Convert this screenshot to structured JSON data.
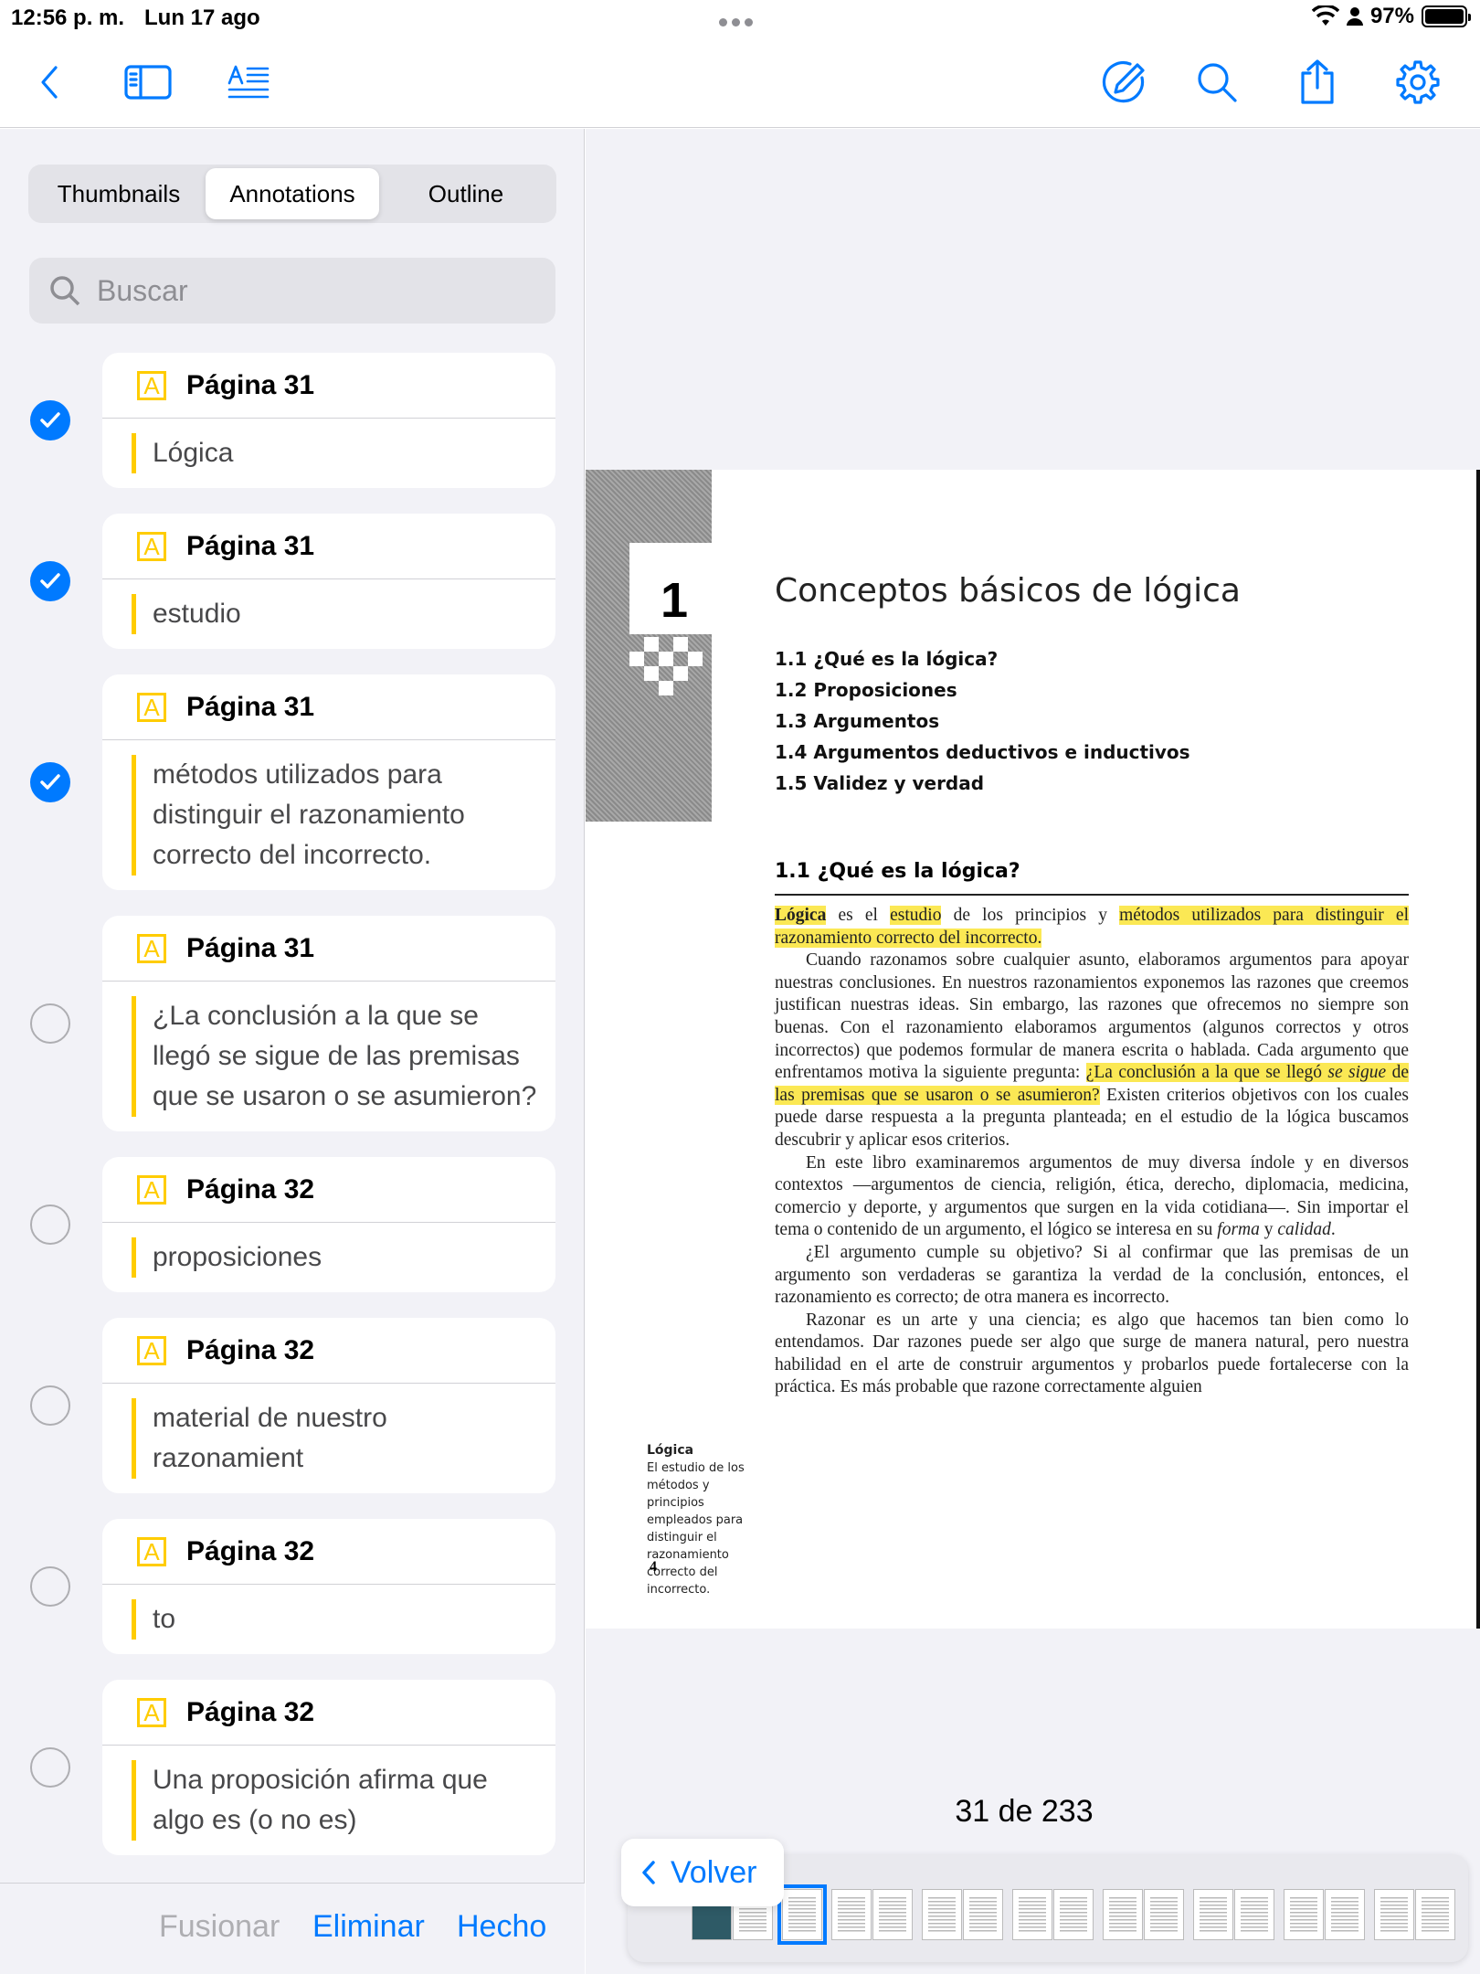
{
  "status_bar": {
    "time": "12:56 p. m.",
    "date": "Lun 17 ago",
    "battery": "97%"
  },
  "toolbar": {
    "left_icons": [
      "back-chevron-icon",
      "sidebar-icon",
      "text-format-icon"
    ],
    "right_icons": [
      "markup-pen-icon",
      "search-icon",
      "share-icon",
      "gear-icon"
    ]
  },
  "sidebar": {
    "tabs": [
      {
        "label": "Thumbnails",
        "active": false
      },
      {
        "label": "Annotations",
        "active": true
      },
      {
        "label": "Outline",
        "active": false
      }
    ],
    "search_placeholder": "Buscar",
    "annotations": [
      {
        "page": "Página 31",
        "text": "Lógica",
        "selected": true
      },
      {
        "page": "Página 31",
        "text": "estudio",
        "selected": true
      },
      {
        "page": "Página 31",
        "text": "métodos utilizados para distinguir el razonamiento correcto del incorrecto.",
        "selected": true
      },
      {
        "page": "Página 31",
        "text": "¿La conclusión a la que se llegó se sigue de las premisas que se usaron o se asumieron?",
        "selected": false
      },
      {
        "page": "Página 32",
        "text": "proposiciones",
        "selected": false
      },
      {
        "page": "Página 32",
        "text": "material de nuestro razonamient",
        "selected": false
      },
      {
        "page": "Página 32",
        "text": "to",
        "selected": false
      },
      {
        "page": "Página 32",
        "text": "Una proposición afirma que algo es (o no es)",
        "selected": false
      }
    ],
    "footer": {
      "merge": "Fusionar",
      "delete": "Eliminar",
      "done": "Hecho"
    }
  },
  "document": {
    "chapter_number": "1",
    "chapter_title": "Conceptos básicos de lógica",
    "toc": [
      "1.1  ¿Qué es la lógica?",
      "1.2  Proposiciones",
      "1.3  Argumentos",
      "1.4  Argumentos deductivos e inductivos",
      "1.5  Validez y verdad"
    ],
    "section_title": "1.1  ¿Qué es la lógica?",
    "p1_a": "Lógica",
    "p1_b": " es el ",
    "p1_c": "estudio",
    "p1_d": " de los principios y ",
    "p1_e": "métodos utilizados para distinguir el razonamiento correcto del incorrecto.",
    "p2_a": "Cuando razonamos sobre cualquier asunto, elaboramos argumentos para apoyar nuestras conclusiones. En nuestros razonamientos exponemos las razones que creemos justifican nuestras ideas. Sin embargo, las razones que ofrecemos no siempre son buenas. Con el razonamiento elaboramos argumentos (algunos correctos y otros incorrectos) que podemos formular de manera escrita o hablada. Cada argumento que enfrentamos motiva la siguiente pregunta: ",
    "p2_b": "¿La conclusión a la que se llegó ",
    "p2_b_em": "se sigue",
    "p2_c": " de las premisas que se usaron o se asumieron?",
    "p2_d": " Existen criterios objetivos con los cuales puede darse respuesta a la pregunta planteada; en el estudio de la lógica buscamos descubrir y aplicar esos criterios.",
    "p3_a": "En este libro examinaremos argumentos de muy diversa índole y en diversos contextos —argumentos de ciencia, religión, ética, derecho, diplomacia, medicina, comercio y deporte, y argumentos que surgen en la vida cotidiana—. Sin importar el tema o contenido de un argumento, el lógico se interesa en su ",
    "p3_em1": "forma",
    "p3_b": " y ",
    "p3_em2": "calidad",
    "p3_c": ".",
    "p4": "¿El argumento cumple su objetivo? Si al confirmar que las premisas de un argumento son verdaderas se garantiza la verdad de la conclusión, entonces, el razonamiento es correcto; de otra manera es incorrecto.",
    "p5": "Razonar es un arte y una ciencia; es algo que hacemos tan bien como lo entendamos. Dar razones puede ser algo que surge de manera natural, pero nuestra habilidad en el arte de construir argumentos y probarlos puede fortalecerse con la práctica. Es más probable que razone correctamente alguien",
    "margin_title": "Lógica",
    "margin_text": "El estudio de los métodos y principios empleados para distinguir el razonamiento correcto del incorrecto.",
    "page_number": "4"
  },
  "navigation": {
    "page_indicator": "31 de 233",
    "back_label": "Volver"
  },
  "colors": {
    "accent": "#007aff",
    "highlight": "#ffcc00",
    "sidebar_bg": "#f2f2f7"
  }
}
